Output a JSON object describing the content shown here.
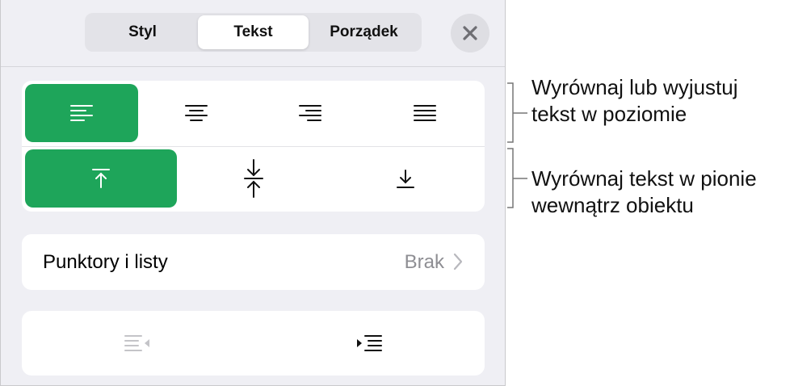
{
  "tabs": [
    {
      "label": "Styl"
    },
    {
      "label": "Tekst"
    },
    {
      "label": "Porządek"
    }
  ],
  "active_tab": "Tekst",
  "accent_color": "#1ea55a",
  "horizontal_alignment": {
    "options": [
      "align-left-icon",
      "align-center-icon",
      "align-right-icon",
      "justify-icon"
    ],
    "selected": "align-left-icon"
  },
  "vertical_alignment": {
    "options": [
      "align-top-icon",
      "align-middle-icon",
      "align-bottom-icon"
    ],
    "selected": "align-top-icon"
  },
  "bullets": {
    "label": "Punktory i listy",
    "value": "Brak"
  },
  "indent": {
    "buttons": [
      "decrease-indent-icon",
      "increase-indent-icon"
    ]
  },
  "callouts": {
    "horizontal": [
      "Wyrównaj lub wyjustuj",
      "tekst w poziomie"
    ],
    "vertical": [
      "Wyrównaj tekst w pionie",
      "wewnątrz obiektu"
    ]
  }
}
